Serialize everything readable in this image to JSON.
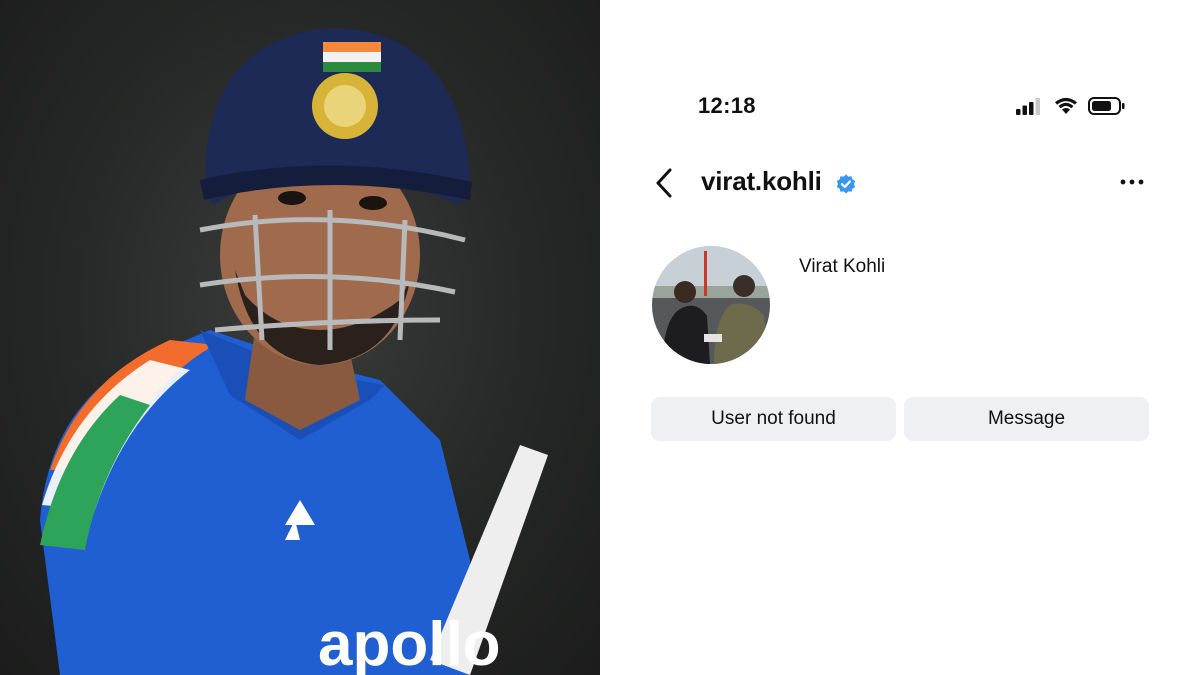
{
  "status_bar": {
    "time": "12:18",
    "icons": [
      "signal-icon",
      "wifi-icon",
      "battery-icon"
    ]
  },
  "profile_header": {
    "username": "virat.kohli",
    "verified": true,
    "icons": [
      "back-chevron-icon",
      "verified-badge-icon",
      "more-options-icon"
    ]
  },
  "profile": {
    "display_name": "Virat Kohli",
    "avatar": "profile-photo"
  },
  "actions": {
    "primary_label": "User not found",
    "secondary_label": "Message"
  },
  "photo": {
    "jersey_text": "apollo",
    "subject": "cricket-player-photo"
  },
  "colors": {
    "verified_blue": "#3897f0",
    "button_bg": "#eef0f3",
    "jersey_blue": "#1f5fd1",
    "helmet_navy": "#1d2a56"
  }
}
